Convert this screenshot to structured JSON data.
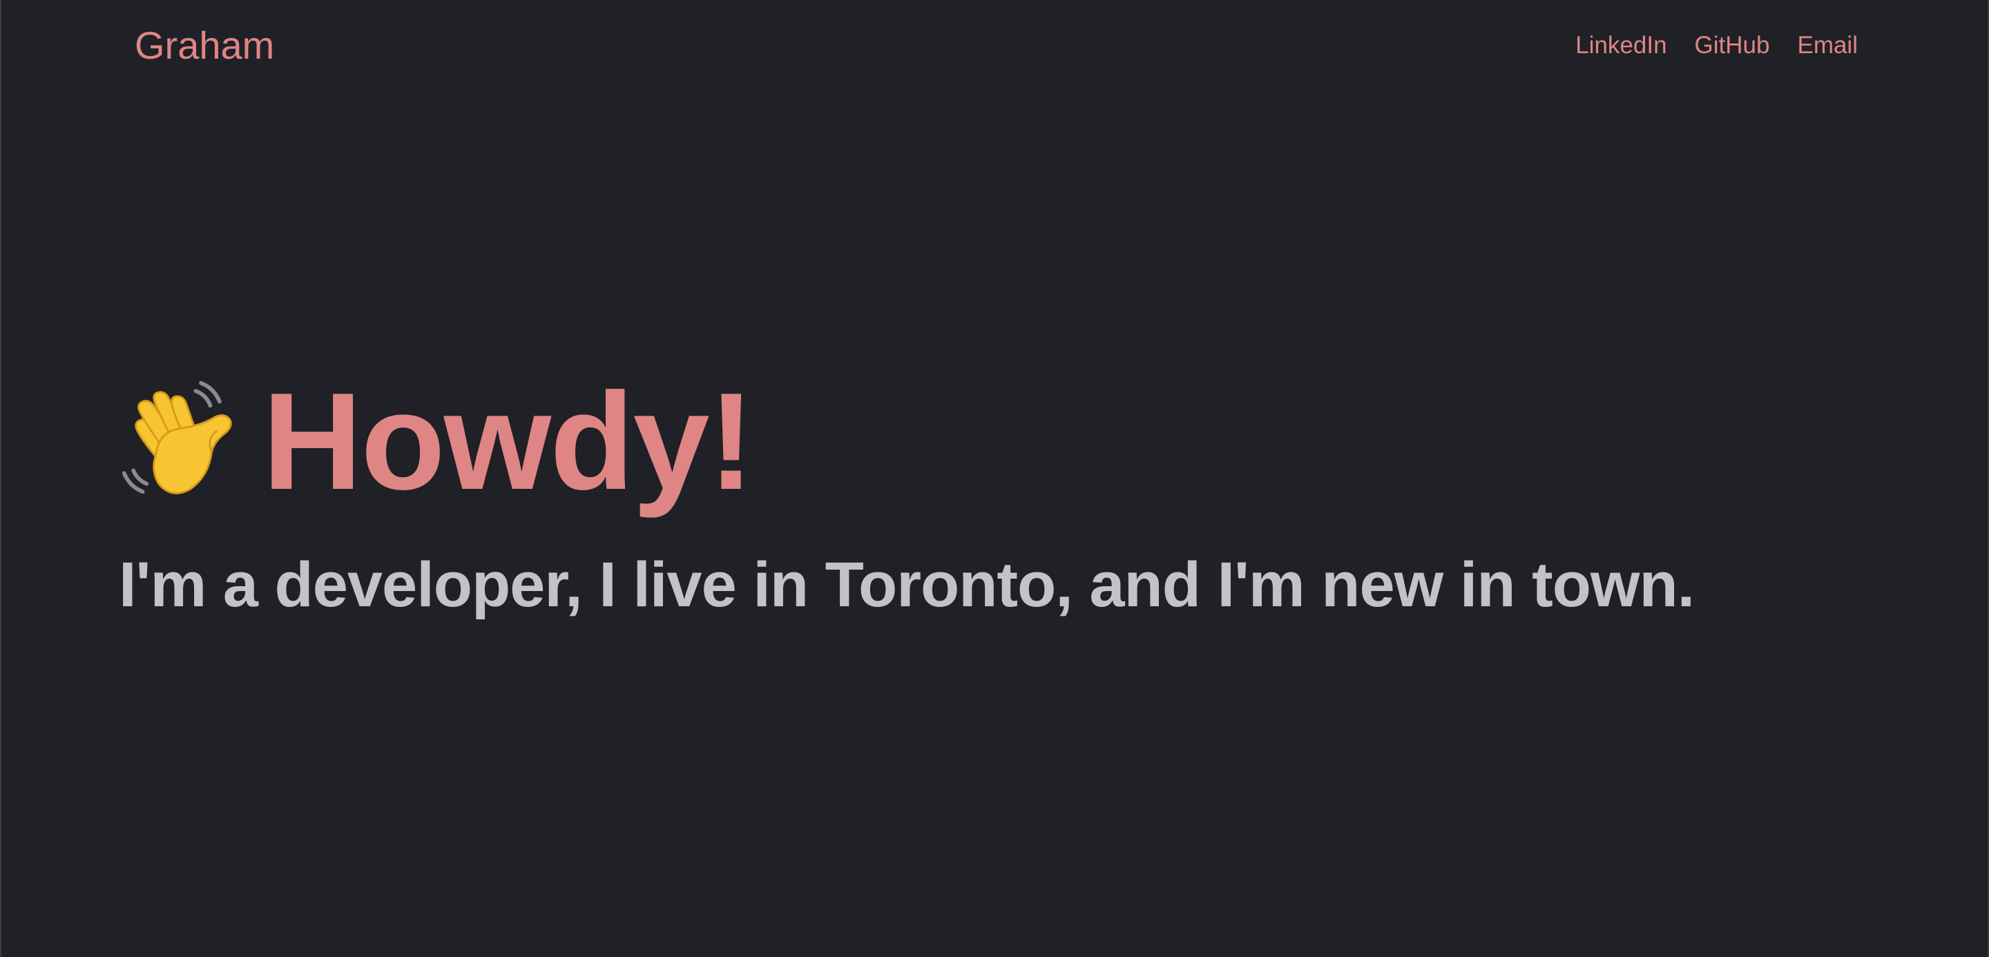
{
  "colors": {
    "background": "#1f2126",
    "accent": "#e08585",
    "text_muted": "#c2c3c6",
    "wave_hand": "#f5c12e"
  },
  "header": {
    "brand": "Graham",
    "nav": [
      {
        "label": "LinkedIn"
      },
      {
        "label": "GitHub"
      },
      {
        "label": "Email"
      }
    ]
  },
  "hero": {
    "icon": "waving-hand-icon",
    "title": "Howdy!",
    "subtitle": "I'm a developer, I live in Toronto, and I'm new in town."
  }
}
